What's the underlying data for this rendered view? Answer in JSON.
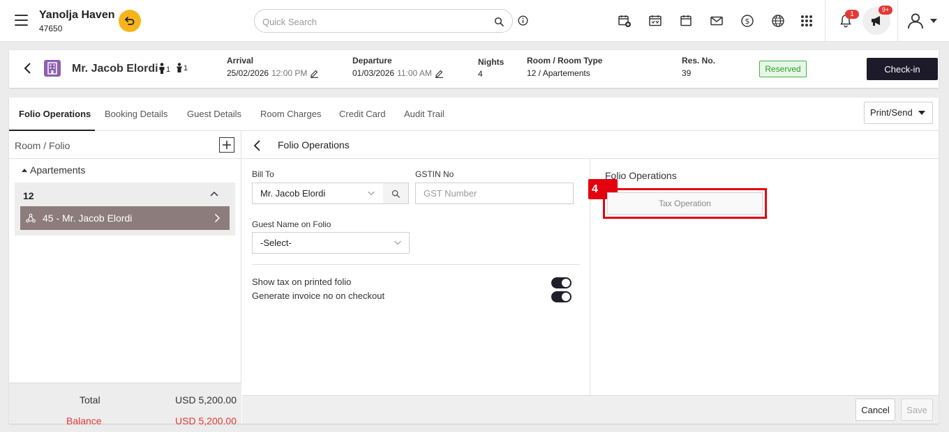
{
  "topbar": {
    "hotel_name": "Yanolja Haven",
    "hotel_id": "47650",
    "search_placeholder": "Quick Search",
    "notifications_count": "1",
    "announcements_count": "9+"
  },
  "reservation": {
    "guest_name": "Mr. Jacob Elordi",
    "adults": "1",
    "children": "1",
    "arrival_label": "Arrival",
    "arrival_date": "25/02/2026",
    "arrival_time": "12:00 PM",
    "departure_label": "Departure",
    "departure_date": "01/03/2026",
    "departure_time": "11:00 AM",
    "nights_label": "Nights",
    "nights": "4",
    "room_label": "Room / Room Type",
    "room_value": "12 / Apartements",
    "resno_label": "Res. No.",
    "resno": "39",
    "status": "Reserved",
    "checkin_label": "Check-in"
  },
  "tabs": [
    {
      "label": "Folio Operations",
      "active": true
    },
    {
      "label": "Booking Details"
    },
    {
      "label": "Guest Details"
    },
    {
      "label": "Room Charges"
    },
    {
      "label": "Credit Card"
    },
    {
      "label": "Audit Trail"
    }
  ],
  "print_send_label": "Print/Send",
  "left_panel": {
    "title": "Room / Folio",
    "group": "Apartements",
    "room_no": "12",
    "folio_item": "45 - Mr. Jacob Elordi",
    "total_label": "Total",
    "total_value": "USD 5,200.00",
    "balance_label": "Balance",
    "balance_value": "USD 5,200.00"
  },
  "folio_form": {
    "header_title": "Folio Operations",
    "bill_to_label": "Bill To",
    "bill_to_value": "Mr. Jacob Elordi",
    "gstin_label": "GSTIN No",
    "gstin_placeholder": "GST Number",
    "guest_name_label": "Guest Name on Folio",
    "guest_name_value": "-Select-",
    "toggle_tax_label": "Show tax on printed folio",
    "toggle_invoice_label": "Generate invoice no on checkout"
  },
  "operations": {
    "title": "Folio Operations",
    "step_number": "4",
    "tax_operation_label": "Tax Operation"
  },
  "footer": {
    "cancel_label": "Cancel",
    "save_label": "Save"
  },
  "colors": {
    "accent_dark": "#1d1b29",
    "undo_yellow": "#f6b41c",
    "status_green": "#2b9d2f",
    "annotation_red": "#e3000f",
    "balance_red": "#e53935",
    "folio_item_bg": "#8c7d7c"
  }
}
